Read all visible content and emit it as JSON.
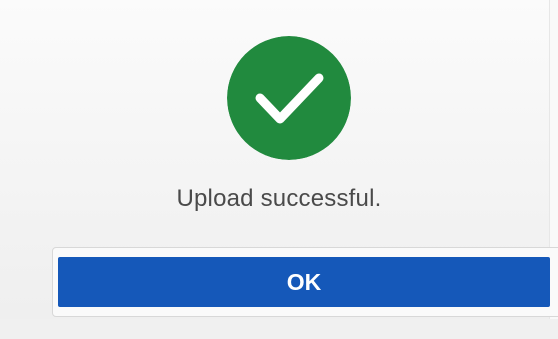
{
  "dialog": {
    "icon": "check-circle-icon",
    "icon_color": "#218a3e",
    "message": "Upload successful.",
    "ok_label": "OK",
    "button_color": "#1558b9"
  }
}
